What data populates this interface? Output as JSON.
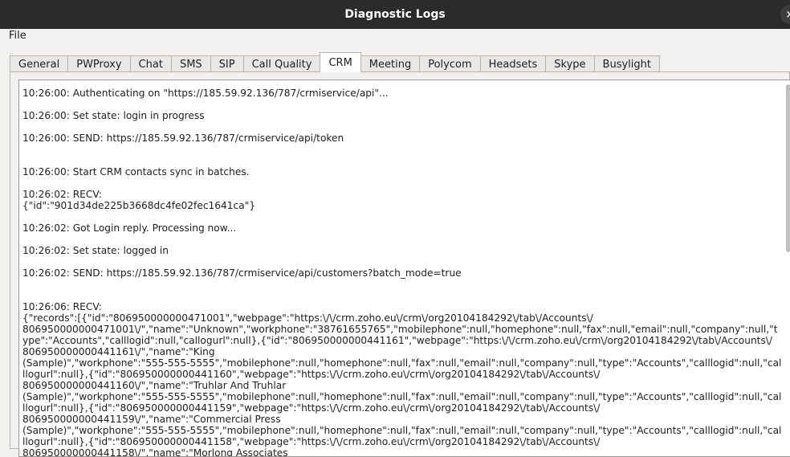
{
  "window": {
    "title": "Diagnostic Logs",
    "close_glyph": "×"
  },
  "menu": {
    "file": "File"
  },
  "tabs": [
    {
      "label": "General"
    },
    {
      "label": "PWProxy"
    },
    {
      "label": "Chat"
    },
    {
      "label": "SMS"
    },
    {
      "label": "SIP"
    },
    {
      "label": "Call Quality"
    },
    {
      "label": "CRM",
      "active": true
    },
    {
      "label": "Meeting"
    },
    {
      "label": "Polycom"
    },
    {
      "label": "Headsets"
    },
    {
      "label": "Skype"
    },
    {
      "label": "Busylight"
    }
  ],
  "log": {
    "lines": [
      "10:26:00: Authenticating on \"https://185.59.92.136/787/crmiservice/api\"...",
      "10:26:00: Set state: login in progress",
      "10:26:00: SEND: https://185.59.92.136/787/crmiservice/api/token",
      "10:26:00: Start CRM contacts sync in batches.",
      "10:26:02: RECV:",
      "{\"id\":\"901d34de225b3668dc4fe02fec1641ca\"}",
      "10:26:02: Got Login reply. Processing now...",
      "10:26:02: Set state: logged in",
      "10:26:02: SEND: https://185.59.92.136/787/crmiservice/api/customers?batch_mode=true",
      "10:26:06: RECV:",
      "{\"records\":[{\"id\":\"806950000000471001\",\"webpage\":\"https:\\/\\/crm.zoho.eu\\/crm\\/org20104184292\\/tab\\/Accounts\\/",
      "806950000000471001\\/\",\"name\":\"Unknown\",\"workphone\":\"38761655765\",\"mobilephone\":null,\"homephone\":null,\"fax\":null,\"email\":null,\"company\":null,\"t",
      "ype\":\"Accounts\",\"calllogid\":null,\"callogurl\":null},{\"id\":\"806950000000441161\",\"webpage\":\"https:\\/\\/crm.zoho.eu\\/crm\\/org20104184292\\/tab\\/Accounts\\/",
      "806950000000441161\\/\",\"name\":\"King",
      "(Sample)\",\"workphone\":\"555-555-5555\",\"mobilephone\":null,\"homephone\":null,\"fax\":null,\"email\":null,\"company\":null,\"type\":\"Accounts\",\"calllogid\":null,\"cal",
      "llogurl\":null},{\"id\":\"806950000000441160\",\"webpage\":\"https:\\/\\/crm.zoho.eu\\/crm\\/org20104184292\\/tab\\/Accounts\\/",
      "806950000000441160\\/\",\"name\":\"Truhlar And Truhlar",
      "(Sample)\",\"workphone\":\"555-555-5555\",\"mobilephone\":null,\"homephone\":null,\"fax\":null,\"email\":null,\"company\":null,\"type\":\"Accounts\",\"calllogid\":null,\"cal",
      "llogurl\":null},{\"id\":\"806950000000441159\",\"webpage\":\"https:\\/\\/crm.zoho.eu\\/crm\\/org20104184292\\/tab\\/Accounts\\/",
      "806950000000441159\\/\",\"name\":\"Commercial Press",
      "(Sample)\",\"workphone\":\"555-555-5555\",\"mobilephone\":null,\"homephone\":null,\"fax\":null,\"email\":null,\"company\":null,\"type\":\"Accounts\",\"calllogid\":null,\"cal",
      "llogurl\":null},{\"id\":\"806950000000441158\",\"webpage\":\"https:\\/\\/crm.zoho.eu\\/crm\\/org20104184292\\/tab\\/Accounts\\/",
      "806950000000441158\\/\",\"name\":\"Morlong Associates"
    ]
  }
}
